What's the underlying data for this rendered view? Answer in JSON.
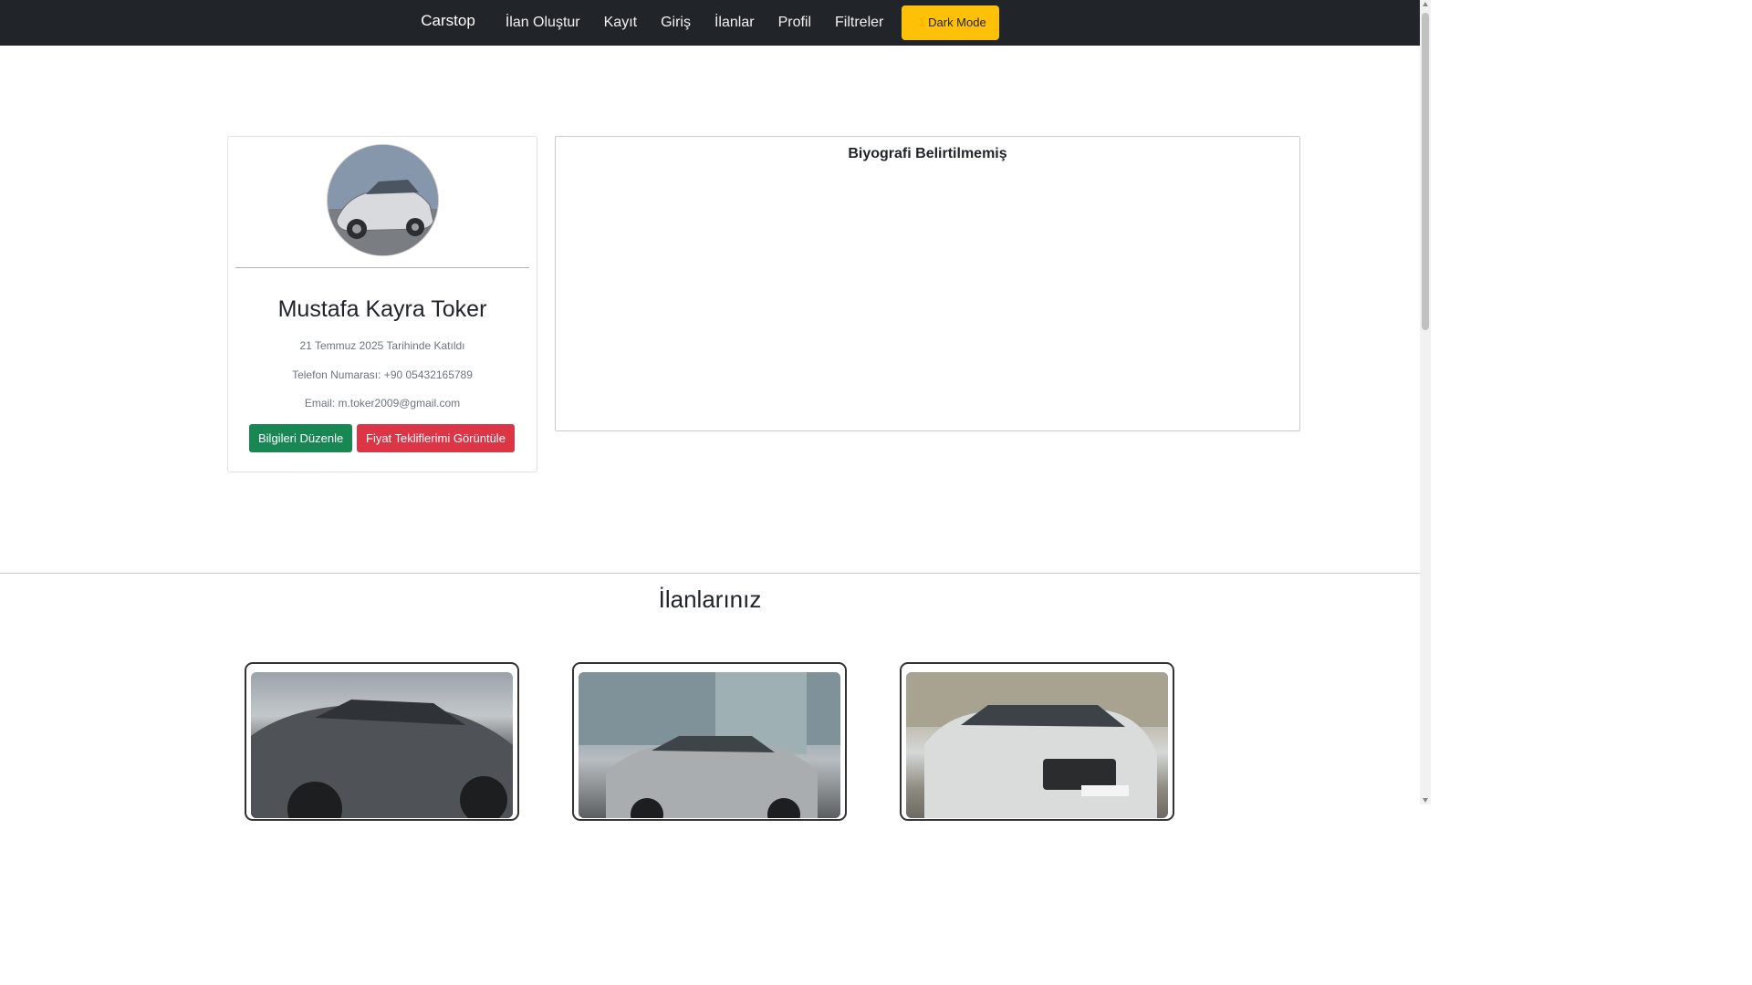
{
  "navbar": {
    "brand": "Carstop",
    "links": [
      "İlan Oluştur",
      "Kayıt",
      "Giriş",
      "İlanlar",
      "Profil",
      "Filtreler"
    ],
    "dark_mode_label": "Dark Mode",
    "dark_mode_icon": "moon-icon",
    "background": "#212529",
    "accent": "#ffc107"
  },
  "profile": {
    "name": "Mustafa Kayra Toker",
    "joined": "21 Temmuz 2025 Tarihinde Katıldı",
    "phone": "Telefon Numarası: +90 05432165789",
    "email": "Email: m.toker2009@gmail.com",
    "edit_button": "Bilgileri Düzenle",
    "offers_button": "Fiyat Tekliflerimi Görüntüle",
    "edit_color": "#198754",
    "offers_color": "#dc3545"
  },
  "bio": {
    "text": "Biyografi Belirtilmemiş"
  },
  "listings": {
    "title": "İlanlarınız"
  }
}
